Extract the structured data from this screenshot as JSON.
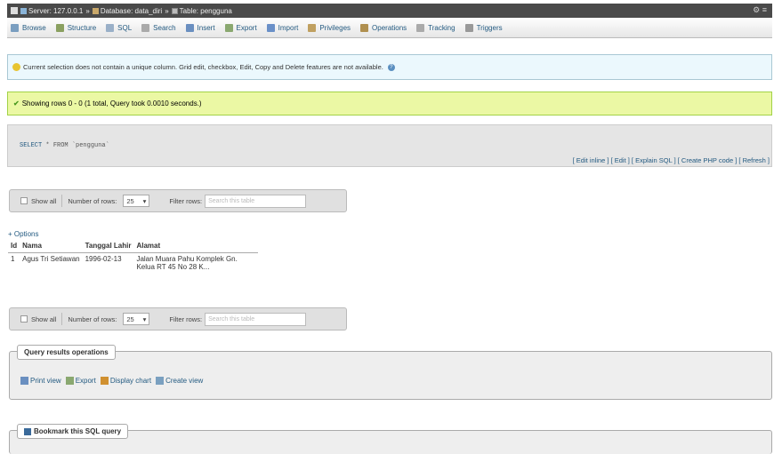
{
  "breadcrumb": {
    "server": "Server: 127.0.0.1",
    "database": "Database: data_diri",
    "table": "Table: pengguna",
    "sep": "»"
  },
  "tabs": [
    {
      "label": "Browse",
      "icon": "browse-icon",
      "color": "#7a9ec0"
    },
    {
      "label": "Structure",
      "icon": "structure-icon",
      "color": "#8aa060"
    },
    {
      "label": "SQL",
      "icon": "sql-icon",
      "color": "#9ab0c8"
    },
    {
      "label": "Search",
      "icon": "search-icon",
      "color": "#aaaaaa"
    },
    {
      "label": "Insert",
      "icon": "insert-icon",
      "color": "#6a8fc0"
    },
    {
      "label": "Export",
      "icon": "export-icon",
      "color": "#8aa870"
    },
    {
      "label": "Import",
      "icon": "import-icon",
      "color": "#6a90c8"
    },
    {
      "label": "Privileges",
      "icon": "privileges-icon",
      "color": "#c0a060"
    },
    {
      "label": "Operations",
      "icon": "operations-icon",
      "color": "#b09050"
    },
    {
      "label": "Tracking",
      "icon": "tracking-icon",
      "color": "#aaaaaa"
    },
    {
      "label": "Triggers",
      "icon": "triggers-icon",
      "color": "#999999"
    }
  ],
  "notice": "Current selection does not contain a unique column. Grid edit, checkbox, Edit, Copy and Delete features are not available.",
  "success": "Showing rows 0 - 0 (1 total, Query took 0.0010 seconds.)",
  "sql": {
    "kw_select": "SELECT",
    "rest": " * FROM `pengguna`",
    "links": "[ Edit inline ] [ Edit ] [ Explain SQL ] [ Create PHP code ] [ Refresh ]"
  },
  "nav": {
    "show_all": "Show all",
    "rows_label": "Number of rows:",
    "rows_value": "25",
    "filter_label": "Filter rows:",
    "filter_placeholder": "Search this table"
  },
  "results": {
    "options": "+ Options",
    "columns": [
      "Id",
      "Nama",
      "Tanggal Lahir",
      "Alamat"
    ],
    "rows": [
      [
        "1",
        "Agus Tri Setiawan",
        "1996-02-13",
        "Jalan Muara Pahu Komplek Gn. Kelua RT 45 No 28 K..."
      ]
    ]
  },
  "query_ops": {
    "legend": "Query results operations",
    "items": [
      {
        "label": "Print view",
        "icon": "print-icon"
      },
      {
        "label": "Export",
        "icon": "export-icon"
      },
      {
        "label": "Display chart",
        "icon": "chart-icon"
      },
      {
        "label": "Create view",
        "icon": "view-icon"
      }
    ]
  },
  "bookmark": {
    "legend": "Bookmark this SQL query"
  }
}
